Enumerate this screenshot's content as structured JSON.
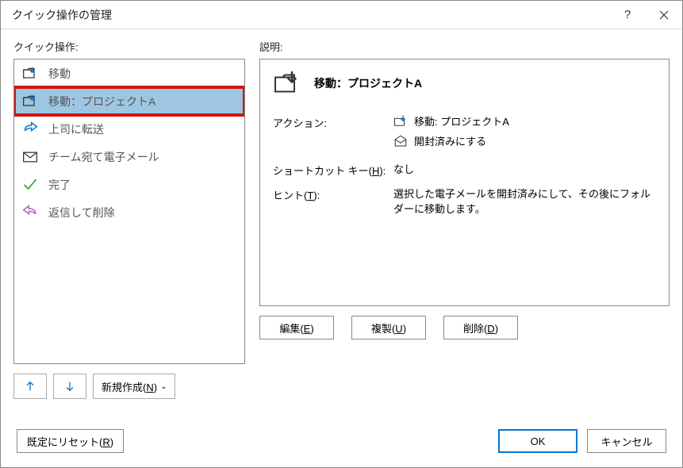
{
  "window": {
    "title": "クイック操作の管理"
  },
  "labels": {
    "quicksteps": "クイック操作:",
    "description": "説明:"
  },
  "list": [
    {
      "icon": "move-folder",
      "label": "移動",
      "selected": false
    },
    {
      "icon": "move-folder",
      "label": "移動：プロジェクトA",
      "selected": true,
      "highlighted": true
    },
    {
      "icon": "forward-arrow",
      "label": "上司に転送",
      "selected": false
    },
    {
      "icon": "envelope",
      "label": "チーム宛て電子メール",
      "selected": false
    },
    {
      "icon": "checkmark",
      "label": "完了",
      "selected": false
    },
    {
      "icon": "reply-undo",
      "label": "返信して削除",
      "selected": false
    }
  ],
  "controls": {
    "new_label": "新規作成(N)"
  },
  "detail": {
    "title": "移動：プロジェクトA",
    "action_label": "アクション:",
    "actions": [
      {
        "icon": "move-folder-blue",
        "text": "移動: プロジェクトA"
      },
      {
        "icon": "envelope-open",
        "text": "開封済みにする"
      }
    ],
    "shortcut_label": "ショートカット キー(H):",
    "shortcut_value": "なし",
    "hint_label": "ヒント(T):",
    "hint_value": "選択した電子メールを開封済みにして、その後にフォルダーに移動します。",
    "buttons": {
      "edit": "編集(E)",
      "duplicate": "複製(U)",
      "delete": "削除(D)"
    }
  },
  "footer": {
    "reset": "既定にリセット(R)",
    "ok": "OK",
    "cancel": "キャンセル"
  }
}
